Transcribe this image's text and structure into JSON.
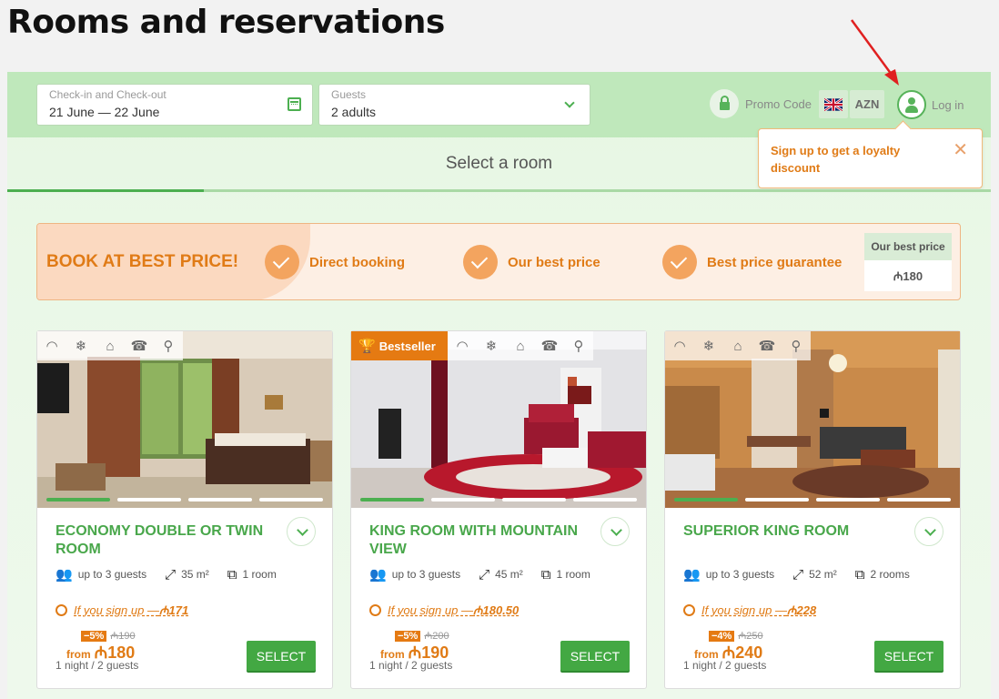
{
  "page": {
    "title": "Rooms and reservations"
  },
  "search": {
    "dates_label": "Check-in and Check-out",
    "dates_value": "21 June — 22 June",
    "guests_label": "Guests",
    "guests_value": "2 adults"
  },
  "header": {
    "promo_code_label": "Promo Code",
    "language": "English",
    "currency": "AZN",
    "login_label": "Log in"
  },
  "tooltip": {
    "text": "Sign up to get a loyalty discount"
  },
  "steps": {
    "current_step": "Select a room"
  },
  "banner": {
    "title": "BOOK AT BEST PRICE!",
    "features": [
      "Direct booking",
      "Our best price",
      "Best price guarantee"
    ],
    "best_price_label": "Our best price",
    "best_price_value": "₼180"
  },
  "rooms": [
    {
      "name": "ECONOMY DOUBLE OR TWIN ROOM",
      "guests": "up to 3 guests",
      "area": "35 m²",
      "rooms": "1 room",
      "signup_text": "If you sign up —",
      "signup_price": "₼171",
      "discount": "−5%",
      "old_price": "₼190",
      "from_label": "from",
      "price": "₼180",
      "per": "1 night / 2 guests",
      "select_label": "SELECT",
      "bestseller": ""
    },
    {
      "name": "KING ROOM WITH MOUNTAIN VIEW",
      "guests": "up to 3 guests",
      "area": "45 m²",
      "rooms": "1 room",
      "signup_text": "If you sign up —",
      "signup_price": "₼180.50",
      "discount": "−5%",
      "old_price": "₼200",
      "from_label": "from",
      "price": "₼190",
      "per": "1 night / 2 guests",
      "select_label": "SELECT",
      "bestseller": "Bestseller"
    },
    {
      "name": "SUPERIOR KING ROOM",
      "guests": "up to 3 guests",
      "area": "52 m²",
      "rooms": "2 rooms",
      "signup_text": "If you sign up —",
      "signup_price": "₼228",
      "discount": "−4%",
      "old_price": "₼250",
      "from_label": "from",
      "price": "₼240",
      "per": "1 night / 2 guests",
      "select_label": "SELECT",
      "bestseller": ""
    }
  ],
  "amenity_icons": [
    "wifi-icon",
    "snowflake-icon",
    "bed-icon",
    "phone-icon",
    "hairdryer-icon"
  ],
  "colors": {
    "accent_green": "#4caf50",
    "accent_orange": "#e07b16",
    "bar_green": "#bfe8bb"
  }
}
